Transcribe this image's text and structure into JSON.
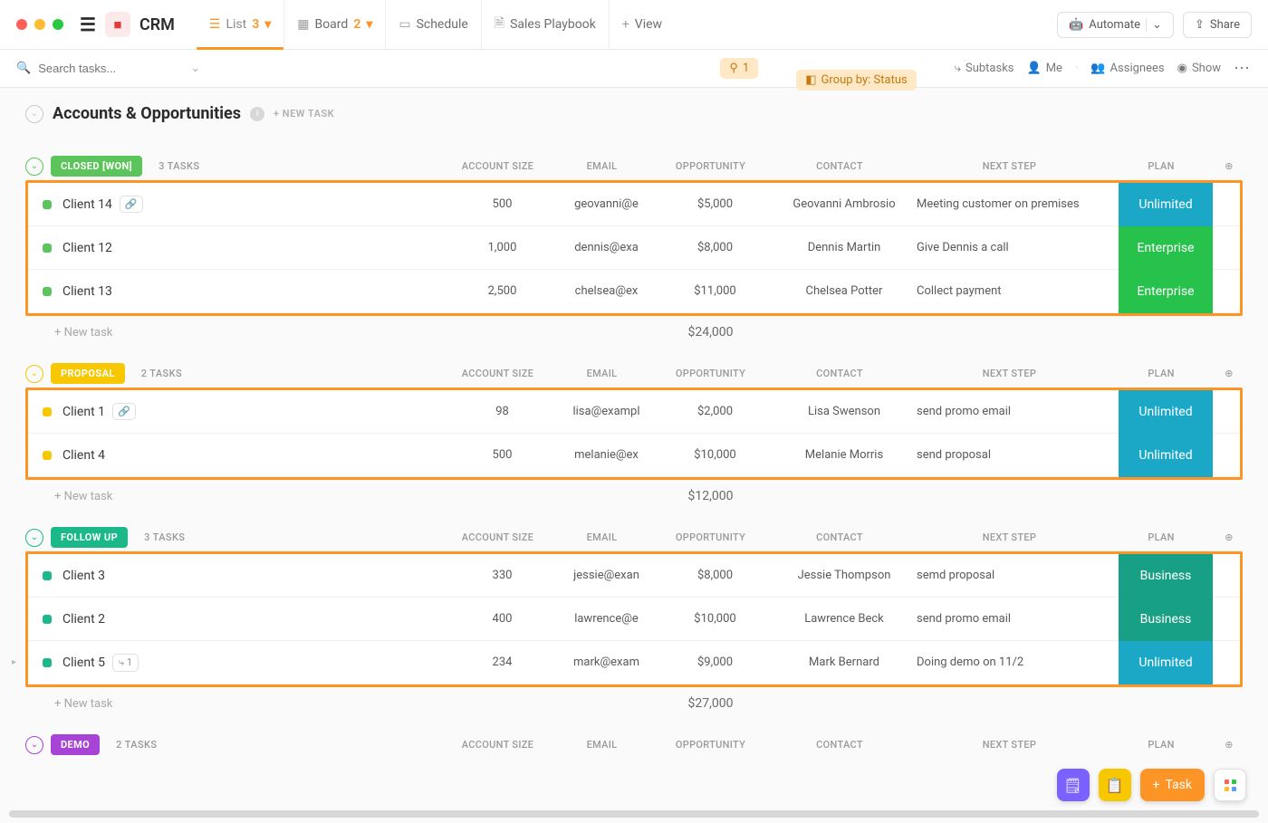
{
  "header": {
    "workspace": "CRM",
    "views": [
      {
        "icon": "list",
        "label": "List",
        "count": "3",
        "active": true
      },
      {
        "icon": "board",
        "label": "Board",
        "count": "2"
      },
      {
        "icon": "schedule",
        "label": "Schedule"
      },
      {
        "icon": "doc",
        "label": "Sales Playbook"
      },
      {
        "icon": "plus",
        "label": "View"
      }
    ],
    "automate": "Automate",
    "share": "Share"
  },
  "toolbar": {
    "search_placeholder": "Search tasks...",
    "filter_count": "1",
    "group_by": "Group by: Status",
    "subtasks": "Subtasks",
    "me": "Me",
    "assignees": "Assignees",
    "show": "Show"
  },
  "list": {
    "title": "Accounts & Opportunities",
    "new_task_label": "+ NEW TASK",
    "columns": [
      "ACCOUNT SIZE",
      "EMAIL",
      "OPPORTUNITY",
      "CONTACT",
      "NEXT STEP",
      "PLAN"
    ],
    "new_task_row": "+ New task"
  },
  "groups": [
    {
      "status": "CLOSED [WON]",
      "badge_class": "sb-green",
      "sq_class": "green",
      "collapse_color": "#5bc55b",
      "tasks_label": "3 TASKS",
      "sum": "$24,000",
      "rows": [
        {
          "name": "Client 14",
          "link": true,
          "acct": "500",
          "email": "geovanni@e",
          "opp": "$5,000",
          "contact": "Geovanni Ambrosio",
          "next": "Meeting customer on premises",
          "plan": "Unlimited",
          "plan_class": "pb-unl"
        },
        {
          "name": "Client 12",
          "acct": "1,000",
          "email": "dennis@exa",
          "opp": "$8,000",
          "contact": "Dennis Martin",
          "next": "Give Dennis a call",
          "plan": "Enterprise",
          "plan_class": "pb-ent"
        },
        {
          "name": "Client 13",
          "acct": "2,500",
          "email": "chelsea@ex",
          "opp": "$11,000",
          "contact": "Chelsea Potter",
          "next": "Collect payment",
          "plan": "Enterprise",
          "plan_class": "pb-ent"
        }
      ]
    },
    {
      "status": "PROPOSAL",
      "badge_class": "sb-yellow",
      "sq_class": "yellow",
      "collapse_color": "#f7c700",
      "tasks_label": "2 TASKS",
      "sum": "$12,000",
      "rows": [
        {
          "name": "Client 1",
          "link": true,
          "acct": "98",
          "email": "lisa@exampl",
          "opp": "$2,000",
          "contact": "Lisa Swenson",
          "next": "send promo email",
          "plan": "Unlimited",
          "plan_class": "pb-unl"
        },
        {
          "name": "Client 4",
          "acct": "500",
          "email": "melanie@ex",
          "opp": "$10,000",
          "contact": "Melanie Morris",
          "next": "send proposal",
          "plan": "Unlimited",
          "plan_class": "pb-unl"
        }
      ]
    },
    {
      "status": "FOLLOW UP",
      "badge_class": "sb-followup",
      "sq_class": "teal",
      "collapse_color": "#1bb98a",
      "tasks_label": "3 TASKS",
      "sum": "$27,000",
      "rows": [
        {
          "name": "Client 3",
          "acct": "330",
          "email": "jessie@exan",
          "opp": "$8,000",
          "contact": "Jessie Thompson",
          "next": "semd proposal",
          "plan": "Business",
          "plan_class": "pb-bus"
        },
        {
          "name": "Client 2",
          "acct": "400",
          "email": "lawrence@e",
          "opp": "$10,000",
          "contact": "Lawrence Beck",
          "next": "send promo email",
          "plan": "Business",
          "plan_class": "pb-bus"
        },
        {
          "name": "Client 5",
          "sub": "1",
          "arrow": true,
          "acct": "234",
          "email": "mark@exam",
          "opp": "$9,000",
          "contact": "Mark Bernard",
          "next": "Doing demo on 11/2",
          "plan": "Unlimited",
          "plan_class": "pb-unl"
        }
      ]
    },
    {
      "status": "DEMO",
      "badge_class": "sb-demo",
      "sq_class": "",
      "collapse_color": "#a744d6",
      "tasks_label": "2 TASKS",
      "sum": "",
      "rows": []
    }
  ],
  "fab": {
    "task": "Task"
  }
}
